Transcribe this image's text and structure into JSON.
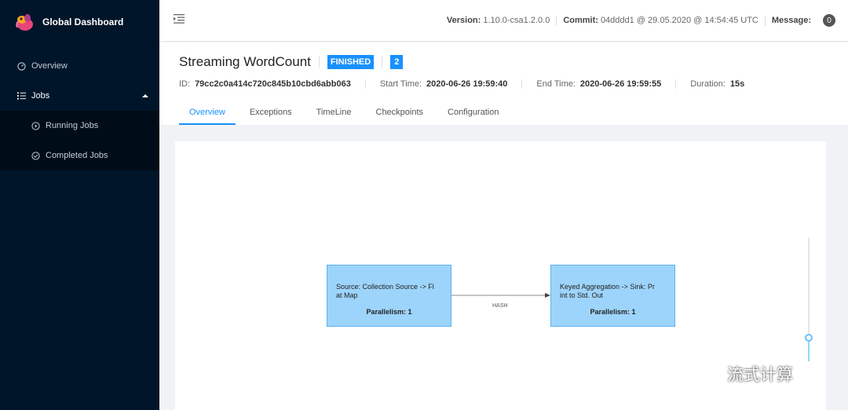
{
  "app": {
    "title": "Global Dashboard"
  },
  "sidebar": {
    "items": [
      {
        "label": "Overview",
        "icon": "dashboard-icon"
      },
      {
        "label": "Jobs",
        "icon": "list-icon",
        "expanded": true,
        "children": [
          {
            "label": "Running Jobs",
            "icon": "play-circle-icon"
          },
          {
            "label": "Completed Jobs",
            "icon": "check-circle-icon"
          }
        ]
      }
    ]
  },
  "header": {
    "version_label": "Version:",
    "version": "1.10.0-csa1.2.0.0",
    "commit_label": "Commit:",
    "commit": "04dddd1 @ 29.05.2020 @ 14:54:45 UTC",
    "message_label": "Message:",
    "message_count": "0"
  },
  "job": {
    "name": "Streaming WordCount",
    "status": "FINISHED",
    "task_count": "2",
    "id_label": "ID:",
    "id": "79cc2c0a414c720c845b10cbd6abb063",
    "start_label": "Start Time:",
    "start_time": "2020-06-26 19:59:40",
    "end_label": "End Time:",
    "end_time": "2020-06-26 19:59:55",
    "duration_label": "Duration:",
    "duration": "15s"
  },
  "tabs": [
    "Overview",
    "Exceptions",
    "TimeLine",
    "Checkpoints",
    "Configuration"
  ],
  "active_tab": "Overview",
  "graph": {
    "nodes": [
      {
        "name": "Source: Collection Source -> Fl\nat Map",
        "parallelism": "Parallelism: 1"
      },
      {
        "name": "Keyed Aggregation -> Sink: Pr\nint to Std. Out",
        "parallelism": "Parallelism: 1"
      }
    ],
    "edge_label": "HASH"
  },
  "zoom": {
    "level": 0.2
  },
  "watermark": {
    "text": "流式计算"
  },
  "colors": {
    "sidebar": "#001529",
    "accent": "#1890ff",
    "node_fill": "#9dd4fb",
    "node_border": "#5bb3f2"
  }
}
